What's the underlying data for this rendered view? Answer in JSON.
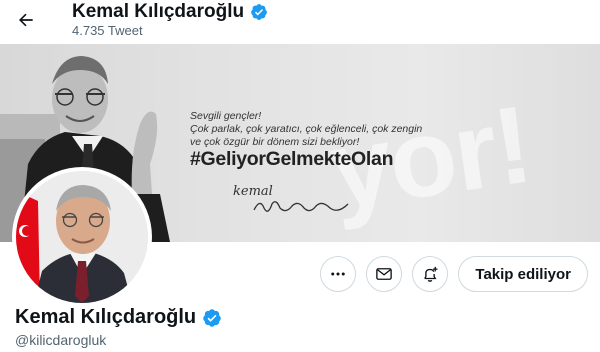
{
  "header": {
    "back_icon": "back-arrow-icon",
    "title": "Kemal Kılıçdaroğlu",
    "tweet_count": "4.735 Tweet",
    "verified_icon": "verified-badge-icon"
  },
  "banner": {
    "message_lines": [
      "Sevgili gençler!",
      "Çok parlak, çok yaratıcı, çok eğlenceli, çok zengin",
      "ve çok özgür bir dönem sizi bekliyor!"
    ],
    "hashtag": "#GeliyorGelmekteOlan",
    "signature_name": "kemal",
    "watermark": "yor!"
  },
  "profile": {
    "name": "Kemal Kılıçdaroğlu",
    "handle": "@kilicdarogluk",
    "verified_icon": "verified-badge-icon"
  },
  "actions": {
    "more_icon": "more-dots-icon",
    "message_icon": "envelope-icon",
    "notify_icon": "bell-plus-icon",
    "follow_label": "Takip ediliyor"
  },
  "colors": {
    "verified": "#1d9bf0",
    "text_secondary": "#536471",
    "border": "#cfd9de"
  }
}
